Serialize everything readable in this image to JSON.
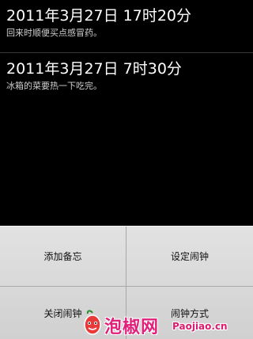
{
  "memos": [
    {
      "time": "2011年3月27日 17时20分",
      "note": "回来时顺便买点感冒药。"
    },
    {
      "time": "2011年3月27日 7时30分",
      "note": "冰箱的菜要热一下吃完。"
    }
  ],
  "menu": {
    "add_memo": "添加备忘",
    "set_alarm": "设定闹钟",
    "close_alarm": "关闭闹钟",
    "alarm_mode": "闹钟方式"
  },
  "watermark": {
    "name": "泡椒网",
    "domain": "Paojiao.cn"
  },
  "colors": {
    "background": "#000000",
    "menu_background": "#d8d8d8",
    "watermark": "#e0207a"
  }
}
